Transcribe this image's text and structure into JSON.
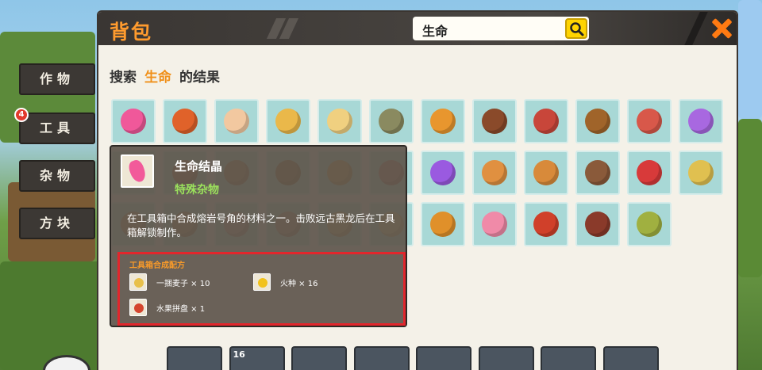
{
  "header": {
    "title": "背包",
    "search_value": "生命"
  },
  "results": {
    "prefix": "搜索",
    "keyword": "生命",
    "suffix": "的结果"
  },
  "tabs": [
    {
      "label": "作物"
    },
    {
      "label": "工具",
      "badge": "4"
    },
    {
      "label": "杂物"
    },
    {
      "label": "方块"
    }
  ],
  "tooltip": {
    "name": "生命结晶",
    "type": "特殊杂物",
    "description": "在工具箱中合成熔岩号角的材料之一。击败远古黑龙后在工具箱解锁制作。",
    "recipe_title": "工具箱合成配方",
    "recipe": [
      {
        "name": "一捆麦子 × 10",
        "icon": "wheat-bundle-icon",
        "color": "#e8c04a"
      },
      {
        "name": "火种 × 16",
        "icon": "fire-seed-icon",
        "color": "#f2c21a"
      },
      {
        "name": "水果拼盘 × 1",
        "icon": "fruit-platter-icon",
        "color": "#d4452e"
      }
    ]
  },
  "grid_items": [
    {
      "icon": "life-crystal-icon",
      "color": "#f0589a"
    },
    {
      "icon": "dice-block-icon",
      "color": "#e0622a"
    },
    {
      "icon": "cake-icon",
      "color": "#f2c8a0"
    },
    {
      "icon": "bread-bun-icon",
      "color": "#eab84a"
    },
    {
      "icon": "fries-icon",
      "color": "#f0d080"
    },
    {
      "icon": "fish-icon",
      "color": "#8a8a60"
    },
    {
      "icon": "waffle-icon",
      "color": "#e8962e"
    },
    {
      "icon": "grilled-dish-icon",
      "color": "#8a4a2a"
    },
    {
      "icon": "meat-bowl-icon",
      "color": "#c8463a"
    },
    {
      "icon": "burger-icon",
      "color": "#a0642a"
    },
    {
      "icon": "sausage-icon",
      "color": "#d8584a"
    },
    {
      "icon": "purple-fruit-icon",
      "color": "#a868e0"
    },
    {
      "icon": "item-icon",
      "color": "#c88a4a"
    },
    {
      "icon": "item-icon",
      "color": "#c06a3a"
    },
    {
      "icon": "item-icon",
      "color": "#b88050"
    },
    {
      "icon": "burger-icon",
      "color": "#a0642a"
    },
    {
      "icon": "bread-icon",
      "color": "#d8a040"
    },
    {
      "icon": "item-icon",
      "color": "#c07060"
    },
    {
      "icon": "purple-fruit-icon",
      "color": "#9a5ae0"
    },
    {
      "icon": "baguette-icon",
      "color": "#e09040"
    },
    {
      "icon": "pie-icon",
      "color": "#d88a3a"
    },
    {
      "icon": "stew-pot-icon",
      "color": "#8a5a3a"
    },
    {
      "icon": "red-drink-icon",
      "color": "#d83a3a"
    },
    {
      "icon": "wheat-bundle-icon",
      "color": "#e0c050"
    },
    {
      "icon": "item-icon",
      "color": "#c08a5a"
    },
    {
      "icon": "item-icon",
      "color": "#c08a5a"
    },
    {
      "icon": "item-icon",
      "color": "#d0a090"
    },
    {
      "icon": "item-icon",
      "color": "#c09070"
    },
    {
      "icon": "item-icon",
      "color": "#e0b060"
    },
    {
      "icon": "fries-icon",
      "color": "#f0d080"
    },
    {
      "icon": "roast-chicken-icon",
      "color": "#e0902a"
    },
    {
      "icon": "ham-slice-icon",
      "color": "#f08aa8"
    },
    {
      "icon": "roast-meat-icon",
      "color": "#d0402a"
    },
    {
      "icon": "soup-bowl-icon",
      "color": "#8a3a2a"
    },
    {
      "icon": "green-melon-icon",
      "color": "#a0b040"
    }
  ],
  "hotbar": [
    {
      "icon": "crossbow-icon",
      "count": ""
    },
    {
      "icon": "bunny-ears-icon",
      "count": "16"
    },
    {
      "icon": "blue-block-icon",
      "count": ""
    },
    {
      "icon": "table-icon",
      "count": ""
    },
    {
      "icon": "purple-item-icon",
      "count": ""
    },
    {
      "icon": "egg-icon",
      "count": ""
    },
    {
      "icon": "blue-orb-icon",
      "count": ""
    },
    {
      "icon": "red-item-icon",
      "count": ""
    }
  ]
}
